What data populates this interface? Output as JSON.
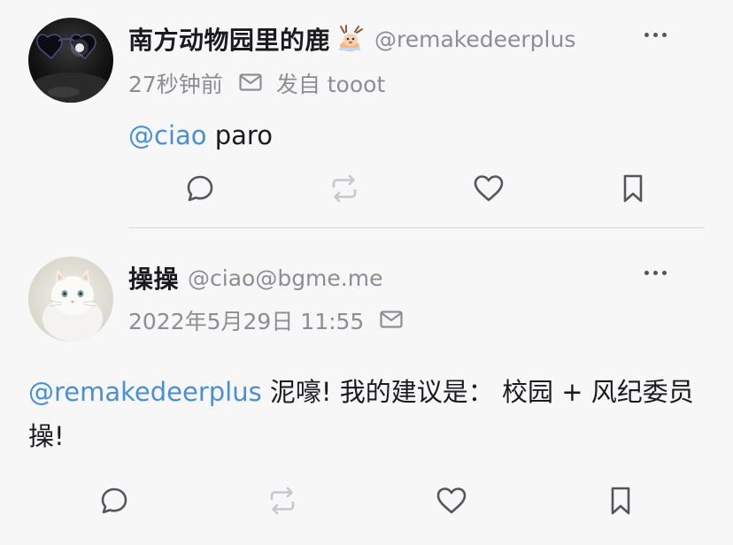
{
  "posts": [
    {
      "display_name": "南方动物园里的鹿",
      "handle": "@remakedeerplus",
      "time": "27秒钟前",
      "via": "发自 tooot",
      "mention": "@ciao",
      "text": " paro",
      "avatar_icon": "heart-sunglasses-avatar",
      "badge_icon": "deer-emoji"
    },
    {
      "display_name": "操操",
      "handle": "@ciao@bgme.me",
      "time": "2022年5月29日 11:55",
      "mention": "@remakedeerplus",
      "text": " 泥嚎! 我的建议是：  校园 + 风纪委员 操!",
      "avatar_icon": "white-cat-avatar"
    }
  ],
  "actions": {
    "reply_icon": "reply-icon",
    "boost_icon": "boost-icon",
    "favourite_icon": "heart-icon",
    "bookmark_icon": "bookmark-icon",
    "more_icon": "more-icon"
  },
  "colors": {
    "background": "#f7f7f8",
    "mention": "#4a8fd6",
    "secondary_text": "#8d8d93",
    "icon": "#55555b",
    "icon_disabled": "#c7c7cc"
  }
}
